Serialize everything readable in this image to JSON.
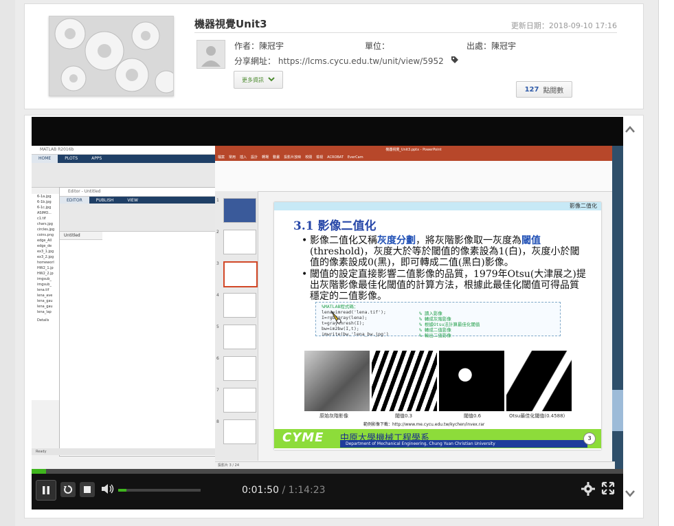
{
  "unit": {
    "title": "機器視覺Unit3",
    "updated": "更新日期：2018-09-10 17:16",
    "author_label": "作者：",
    "author": "陳冠宇",
    "unit_label": "單位：",
    "unit_value": "",
    "source_label": "出處：",
    "source": "陳冠宇",
    "share_label": "分享網址：",
    "share_url": "https://lcms.cycu.edu.tw/unit/view/5952",
    "more_label": "更多資訊",
    "views_count": "127",
    "views_label": "點閱數"
  },
  "matlab": {
    "title": "MATLAB R2016b",
    "tabs": [
      "HOME",
      "PLOTS",
      "APPS"
    ],
    "editor_title": "Editor - Untitled",
    "editor_tabs": [
      "EDITOR",
      "PUBLISH",
      "VIEW"
    ],
    "untitled": "Untitled",
    "files": [
      "6-1a.jpg",
      "6-1b.jpg",
      "6-1c.jpg",
      "ASIMO...",
      "c1.tif",
      "chars.jpg",
      "circles.jpg",
      "coins.png",
      "edge_All",
      "edge_de",
      "ex3_1.jpg",
      "ex3_2.jpg",
      "homeworl",
      "HW2_1.jp",
      "HW2_2.jp",
      "imgsub_",
      "imgsub_",
      "lena.tif",
      "lena_ave",
      "lena_gau",
      "lena_gau",
      "lena_lap"
    ],
    "details": "Details",
    "status": "Ready",
    "script": "script"
  },
  "ppt": {
    "title": "機器視覺_Unit3.pptx - PowerPoint",
    "menu": [
      "檔案",
      "常用",
      "插入",
      "設計",
      "轉場",
      "動畫",
      "投影片放映",
      "校閱",
      "檢視",
      "ACROBAT",
      "EverCam"
    ],
    "status": "投影片 3 / 24",
    "slide": {
      "band": "影像二值化",
      "heading": "3.1 影像二值化",
      "bullet1_a": "影像二值化又稱",
      "bullet1_hl": "灰度分劃",
      "bullet1_b": "，將灰階影像取一灰度為",
      "bullet1_hl2": "閾值",
      "bullet1_c": "(threshold)，灰度大於等於閾值的像素設為1(白)，灰度小於閾值的像素設成0(黑)，即可轉成二值(黑白)影像。",
      "bullet2": "閾值的設定直接影響二值影像的品質，1979年Otsu(大津展之)提出灰階影像最佳化閾值的計算方法，根據此最佳化閾值可得品質穩定的二值影像。",
      "code_lines": [
        "%MATLAB程式碼：",
        "lena=imread('lena.tif');",
        "I=rgb2gray(lena);",
        "t=graythresh(I);",
        "bw=im2bw(I,t);",
        "imwrite(bw,'lena_bw.jpg')"
      ],
      "code_comments": [
        "% 讀入影像",
        "% 轉成灰階影像",
        "% 根據Otsu法計算最佳化閾值",
        "% 轉成二值影像",
        "% 輸出二值影像"
      ],
      "captions": [
        "原始灰階影像",
        "閾值0.3",
        "閾值0.6",
        "Otsu最佳化閾值(0.4588)"
      ],
      "download": "範例影像下載：http://www.me.cycu.edu.tw/kychen/invex.rar",
      "footer_logo": "CYME",
      "footer_univ": "中原大學機械工程學系",
      "footer_dept": "Department of Mechanical Engineering, Chung Yuan Christian University",
      "page_num": "3"
    }
  },
  "player": {
    "current_time": "0:01:50",
    "separator": "/",
    "total_time": "1:14:23",
    "progress": 0.0247,
    "volume": 0.1
  },
  "colors": {
    "accent_green": "#3fb51e",
    "slide_blue": "#2747a8",
    "ppt_red": "#b7472a"
  }
}
